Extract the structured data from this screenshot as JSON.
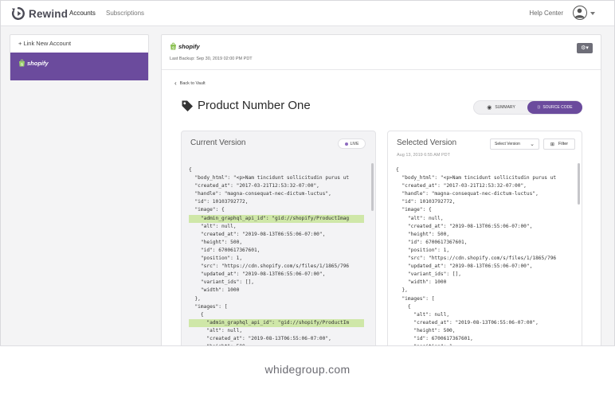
{
  "nav": {
    "logo_text": "Rewind",
    "links": [
      "Accounts",
      "Subscriptions"
    ],
    "help": "Help Center"
  },
  "sidebar": {
    "link_new": "+ Link New Account",
    "account_label": "shopify"
  },
  "main": {
    "store_label": "shopify",
    "last_backup": "Last Backup: Sep 30, 2019 02:00 PM PDT",
    "back": "Back to Vault",
    "title": "Product Number One",
    "toggle": {
      "summary": "SUMMARY",
      "source": "SOURCE CODE"
    }
  },
  "current": {
    "title": "Current Version",
    "badge": "LIVE",
    "lines": [
      "{",
      "  \"body_html\": \"<p>Nam tincidunt sollicitudin purus ut",
      "  \"created_at\": \"2017-03-21T12:53:32-07:00\",",
      "  \"handle\": \"magna-consequat-nec-dictum-luctus\",",
      "  \"id\": 10103792772,",
      "  \"image\": {",
      "    \"admin_graphql_api_id\": \"gid://shopify/ProductImag",
      "    \"alt\": null,",
      "    \"created_at\": \"2019-08-13T06:55:06-07:00\",",
      "    \"height\": 500,",
      "    \"id\": 6700617367601,",
      "    \"position\": 1,",
      "    \"src\": \"https://cdn.shopify.com/s/files/1/1865/796",
      "    \"updated_at\": \"2019-08-13T06:55:06-07:00\",",
      "    \"variant_ids\": [],",
      "    \"width\": 1000",
      "  },",
      "  \"images\": [",
      "    {",
      "      \"admin_graphql_api_id\": \"gid://shopify/ProductIm",
      "      \"alt\": null,",
      "      \"created_at\": \"2019-08-13T06:55:06-07:00\",",
      "      \"height\": 500"
    ]
  },
  "selected": {
    "title": "Selected Version",
    "date": "Aug 13, 2019 6:55 AM PDT",
    "dropdown": "Select Version",
    "filter": "Filter",
    "lines": [
      "{",
      "  \"body_html\": \"<p>Nam tincidunt sollicitudin purus ut",
      "  \"created_at\": \"2017-03-21T12:53:32-07:00\",",
      "  \"handle\": \"magna-consequat-nec-dictum-luctus\",",
      "  \"id\": 10103792772,",
      "  \"image\": {",
      "    \"alt\": null,",
      "    \"created_at\": \"2019-08-13T06:55:06-07:00\",",
      "    \"height\": 500,",
      "    \"id\": 6700617367601,",
      "    \"position\": 1,",
      "    \"src\": \"https://cdn.shopify.com/s/files/1/1865/796",
      "    \"updated_at\": \"2019-08-13T06:55:06-07:00\",",
      "    \"variant_ids\": [],",
      "    \"width\": 1000",
      "  },",
      "  \"images\": [",
      "    {",
      "      \"alt\": null,",
      "      \"created_at\": \"2019-08-13T06:55:06-07:00\",",
      "      \"height\": 500,",
      "      \"id\": 6700617367601,",
      "      \"position\": 1"
    ]
  },
  "highlight_lines": [
    6,
    19
  ],
  "watermark": "whidegroup.com",
  "colors": {
    "accent": "#6b4b9d",
    "highlight": "#cfe7a8",
    "live_dot": "#8d6bbf"
  }
}
